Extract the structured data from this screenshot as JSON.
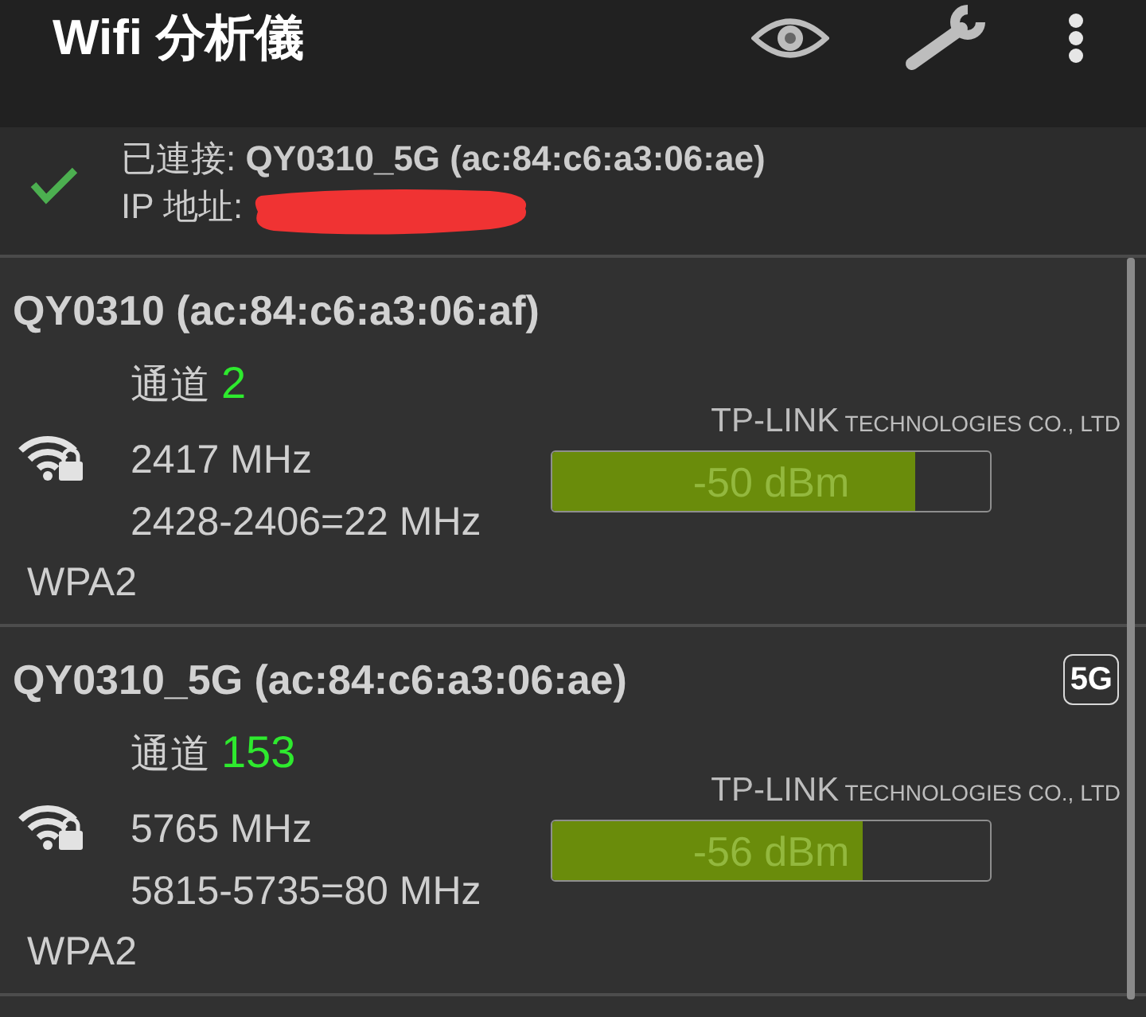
{
  "app_bar": {
    "title": "Wifi 分析儀"
  },
  "connection": {
    "connected": true,
    "status": "已連接: **QY0310_5G (ac:84:c6:a3:06:ae)**",
    "ip_label": "IP 地址:",
    "ip_redacted": true
  },
  "networks": [
    {
      "name": "QY0310 (ac:84:c6:a3:06:af)",
      "channel_label": "通道",
      "channel": "2",
      "secured": true,
      "frequency": "2417 MHz",
      "width": "2428-2406=22 MHz",
      "vendor": "TP-LINK TECHNOLOGIES CO., LTD",
      "level": 0.83,
      "reading": "-50 dBm",
      "security": "WPA2"
    },
    {
      "name": "QY0310_5G (ac:84:c6:a3:06:ae)",
      "band": "5G",
      "channel_label": "通道",
      "channel": "153",
      "secured": true,
      "frequency": "5765 MHz",
      "width": "5815-5735=80 MHz",
      "vendor": "TP-LINK TECHNOLOGIES CO., LTD",
      "level": 0.71,
      "reading": "-56 dBm",
      "security": "WPA2"
    }
  ]
}
